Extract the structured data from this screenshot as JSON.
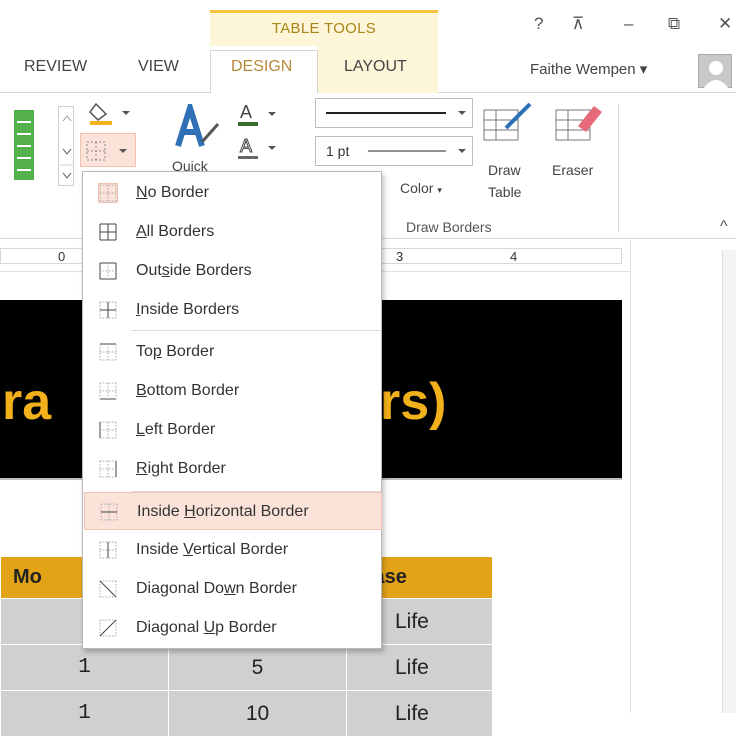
{
  "window": {
    "contextual_group": "TABLE TOOLS",
    "help": "?",
    "ribbon_display": "⊼",
    "minimize": "–",
    "restore": "⧉",
    "close": "✕"
  },
  "tabs": [
    "REVIEW",
    "VIEW",
    "DESIGN",
    "LAYOUT"
  ],
  "user": {
    "name": "Faithe Wempen ▾"
  },
  "ribbon": {
    "quick_styles_label": "Quick",
    "line_weight": "1 pt",
    "pen_color": "Color",
    "draw_table": [
      "Draw",
      "Table"
    ],
    "eraser": "Eraser",
    "group_draw_borders": "Draw Borders",
    "collapse": "^"
  },
  "ruler": {
    "marks": [
      "0",
      "3",
      "4"
    ]
  },
  "document": {
    "heading_left": "ra",
    "heading_right": "rs)",
    "table": {
      "headers": [
        "Mo",
        "",
        "Case"
      ],
      "rows": [
        [
          "",
          "",
          "Life"
        ],
        [
          "1",
          "5",
          "Life"
        ],
        [
          "1",
          "10",
          "Life"
        ]
      ]
    }
  },
  "menu": {
    "items": [
      {
        "pre": "",
        "u": "N",
        "post": "o Border",
        "icon": "no-border"
      },
      {
        "pre": "",
        "u": "A",
        "post": "ll Borders",
        "icon": "all-borders"
      },
      {
        "pre": "Out",
        "u": "s",
        "post": "ide Borders",
        "icon": "outside-borders"
      },
      {
        "pre": "",
        "u": "I",
        "post": "nside Borders",
        "icon": "inside-borders"
      },
      {
        "pre": "To",
        "u": "p",
        "post": " Border",
        "icon": "top-border"
      },
      {
        "pre": "",
        "u": "B",
        "post": "ottom Border",
        "icon": "bottom-border"
      },
      {
        "pre": "",
        "u": "L",
        "post": "eft Border",
        "icon": "left-border"
      },
      {
        "pre": "",
        "u": "R",
        "post": "ight Border",
        "icon": "right-border"
      },
      {
        "pre": "Inside ",
        "u": "H",
        "post": "orizontal Border",
        "icon": "inside-horizontal-border"
      },
      {
        "pre": "Inside ",
        "u": "V",
        "post": "ertical Border",
        "icon": "inside-vertical-border"
      },
      {
        "pre": "Diagonal Do",
        "u": "w",
        "post": "n Border",
        "icon": "diagonal-down-border"
      },
      {
        "pre": "Diagonal ",
        "u": "U",
        "post": "p Border",
        "icon": "diagonal-up-border"
      }
    ]
  },
  "colors": {
    "accent_gold": "#f2b01a",
    "menu_hover": "#fbe3da",
    "context_tab": "#fdf6d8"
  }
}
